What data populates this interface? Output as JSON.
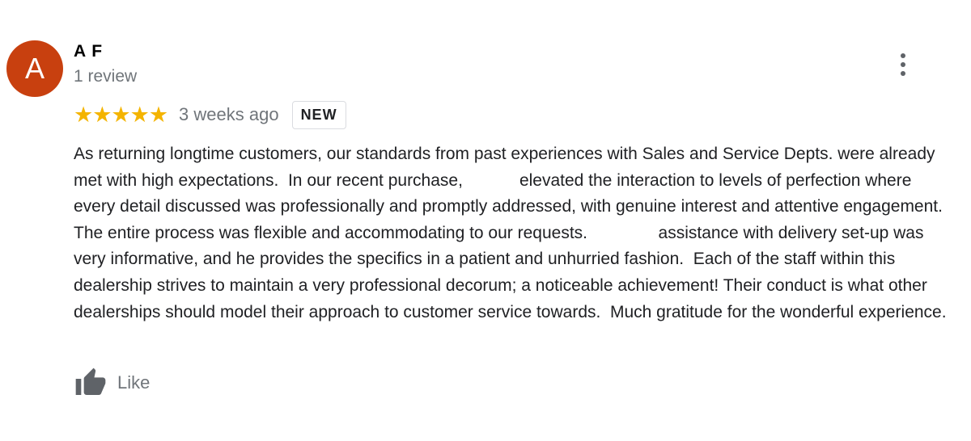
{
  "review": {
    "avatar_letter": "A",
    "avatar_color": "#c8400f",
    "author_name": "A F",
    "review_count": "1 review",
    "stars": "★★★★★",
    "rating": 5,
    "time_ago": "3 weeks ago",
    "badge": "NEW",
    "text": "As returning longtime customers, our standards from past experiences with Sales and Service Depts. were already met with high expectations.  In our recent purchase,            elevated the interaction to levels of perfection where every detail discussed was professionally and promptly addressed, with genuine interest and attentive engagement.  The entire process was flexible and accommodating to our requests.               assistance with delivery set-up was very informative, and he provides the specifics in a patient and unhurried fashion.  Each of the staff within this dealership strives to maintain a very professional decorum; a noticeable achievement! Their conduct is what other dealerships should model their approach to customer service towards.  Much gratitude for the wonderful experience.",
    "like_label": "Like"
  },
  "icons": {
    "more": "more-vert-icon",
    "like": "thumbs-up-icon"
  },
  "colors": {
    "star": "#f4b400",
    "secondary_text": "#70757a",
    "icon": "#5f6368"
  }
}
